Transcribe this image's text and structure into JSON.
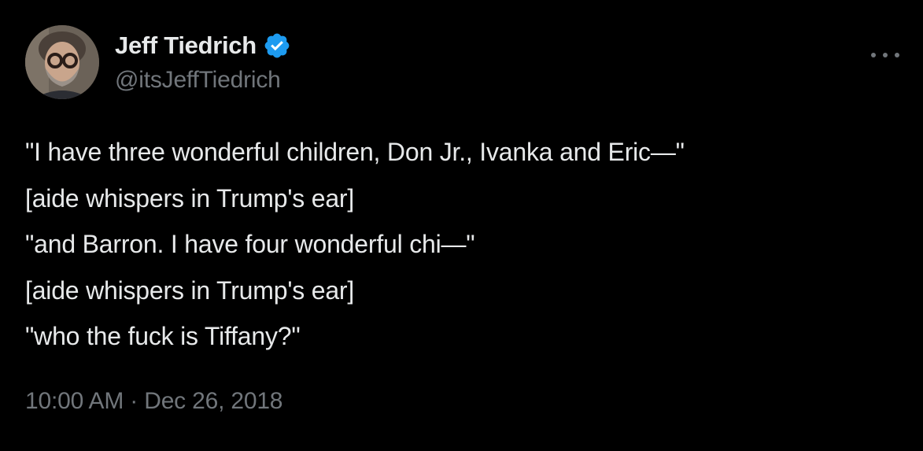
{
  "author": {
    "display_name": "Jeff Tiedrich",
    "handle": "@itsJeffTiedrich",
    "verified": true,
    "avatar_icon": "person-with-glasses-avatar"
  },
  "tweet": {
    "lines": [
      "\"I have three wonderful children, Don Jr., Ivanka and Eric—\"",
      "[aide whispers in Trump's ear]",
      "\"and Barron. I have four wonderful chi—\"",
      "[aide whispers in Trump's ear]",
      "\"who the fuck is Tiffany?\""
    ],
    "time": "10:00 AM",
    "separator": "·",
    "date": "Dec 26, 2018"
  },
  "icons": {
    "verified": "verified-badge-icon",
    "more": "more-options-icon"
  },
  "colors": {
    "background": "#000000",
    "primary_text": "#e7e9ea",
    "secondary_text": "#71767b",
    "verified_blue": "#1d9bf0"
  }
}
